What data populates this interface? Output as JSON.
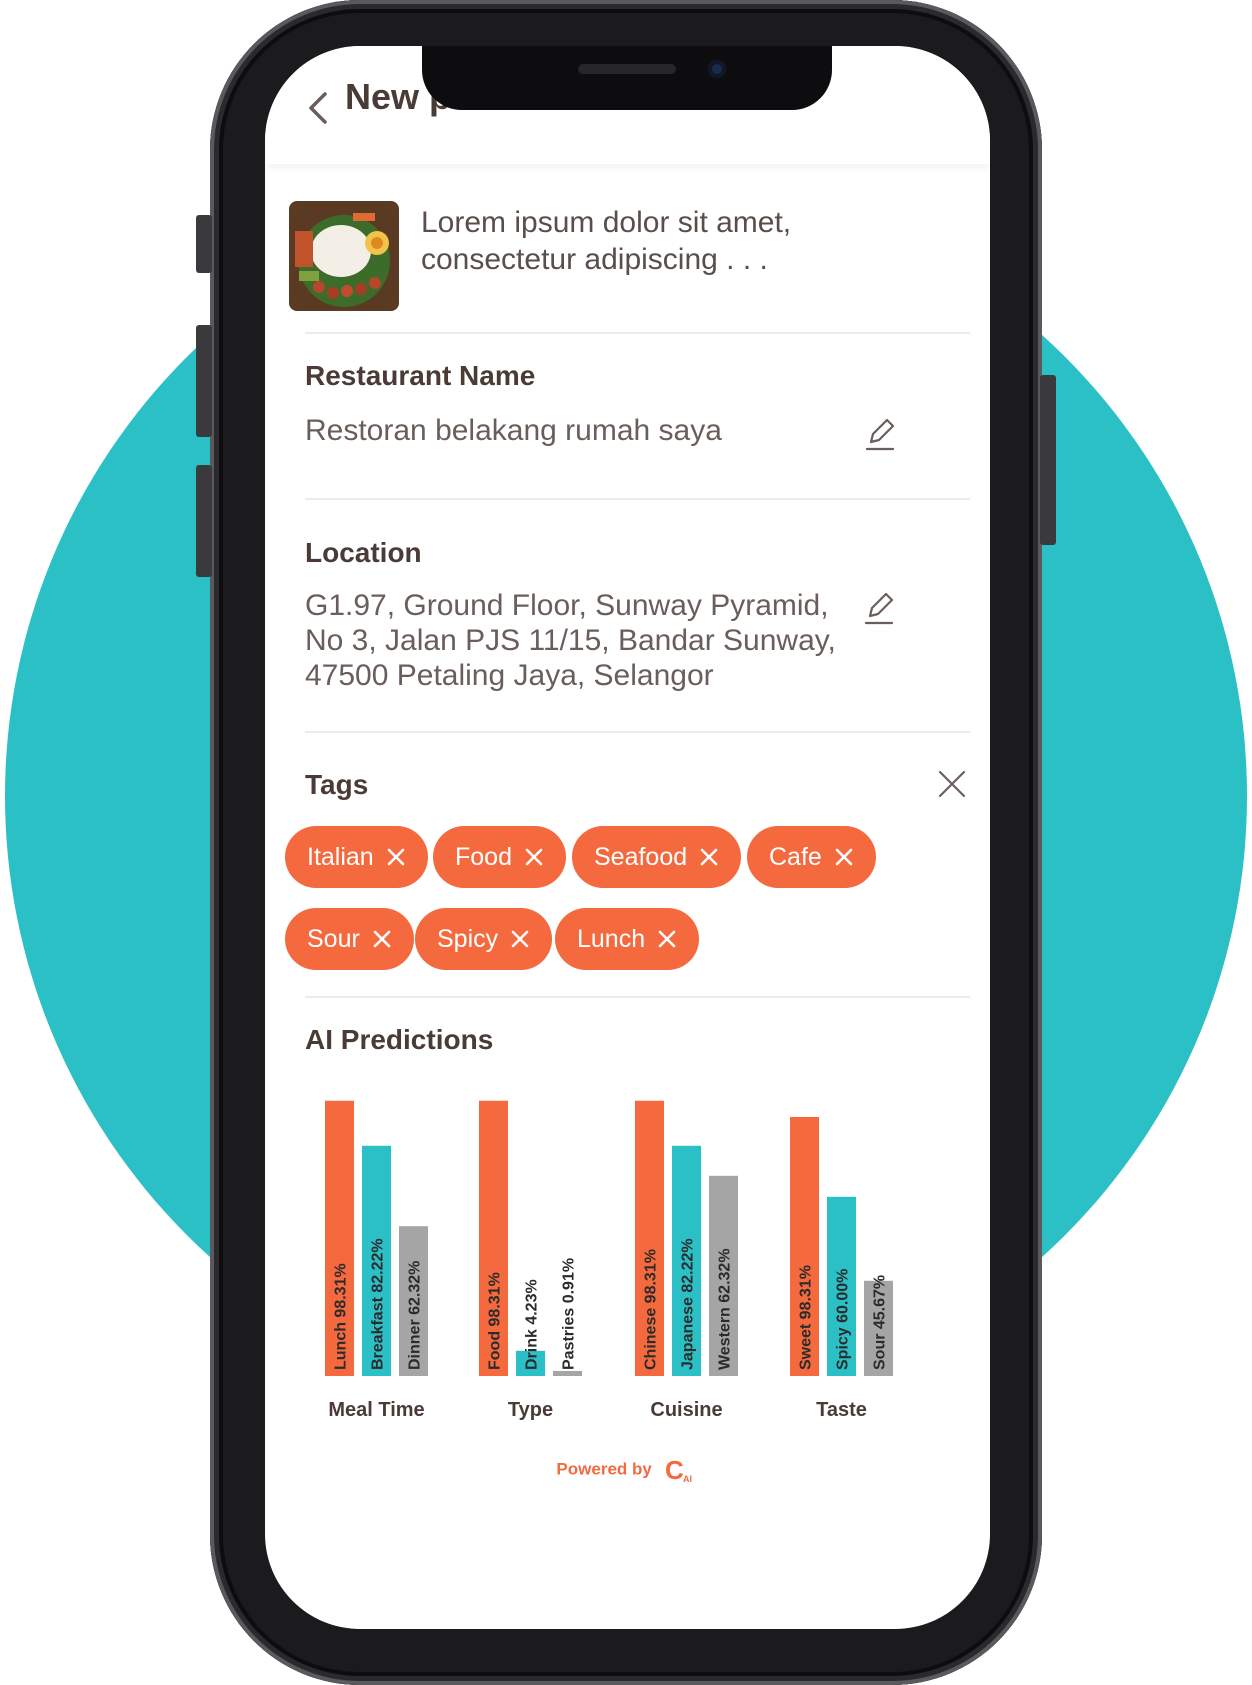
{
  "header": {
    "title": "New post"
  },
  "post": {
    "caption": "Lorem ipsum dolor sit amet, consectetur adipiscing . . ."
  },
  "restaurant": {
    "label": "Restaurant Name",
    "value": "Restoran belakang rumah saya"
  },
  "location": {
    "label": "Location",
    "lines": [
      "G1.97, Ground Floor, Sunway Pyramid,",
      "No 3, Jalan PJS 11/15, Bandar Sunway,",
      "47500 Petaling Jaya, Selangor"
    ]
  },
  "tags": {
    "label": "Tags",
    "items": [
      "Italian",
      "Food",
      "Seafood",
      "Cafe",
      "Sour",
      "Spicy",
      "Lunch"
    ]
  },
  "predictions": {
    "label": "AI Predictions"
  },
  "colors": {
    "accent": "#f4693e",
    "teal": "#2bbfc6",
    "gray": "#a5a5a5",
    "text": "#4a3b36"
  },
  "chart_data": {
    "type": "bar",
    "title": "",
    "ylim": [
      0,
      100
    ],
    "groups": [
      {
        "name": "Meal Time",
        "bars": [
          {
            "label": "Lunch 98.31%",
            "value": 98.31,
            "color": "orange"
          },
          {
            "label": "Breakfast 82.22%",
            "value": 82.22,
            "color": "teal"
          },
          {
            "label": "Dinner 62.32%",
            "value": 53.5,
            "color": "gray"
          }
        ]
      },
      {
        "name": "Type",
        "bars": [
          {
            "label": "Food 98.31%",
            "value": 98.31,
            "color": "orange"
          },
          {
            "label": "Drink 4.23%",
            "value": 9.0,
            "color": "teal"
          },
          {
            "label": "Pastries 0.91%",
            "value": 1.8,
            "color": "gray"
          }
        ]
      },
      {
        "name": "Cuisine",
        "bars": [
          {
            "label": "Chinese 98.31%",
            "value": 98.31,
            "color": "orange"
          },
          {
            "label": "Japanese 82.22%",
            "value": 82.22,
            "color": "teal"
          },
          {
            "label": "Western 62.32%",
            "value": 71.5,
            "color": "gray"
          }
        ]
      },
      {
        "name": "Taste",
        "bars": [
          {
            "label": "Sweet 98.31%",
            "value": 92.5,
            "color": "orange"
          },
          {
            "label": "Spicy 60.00%",
            "value": 64.0,
            "color": "teal"
          },
          {
            "label": "Sour 45.67%",
            "value": 34.0,
            "color": "gray"
          }
        ]
      }
    ]
  },
  "footer": {
    "powered_by": "Powered by",
    "logo_text": "C",
    "logo_sub": "AI"
  }
}
